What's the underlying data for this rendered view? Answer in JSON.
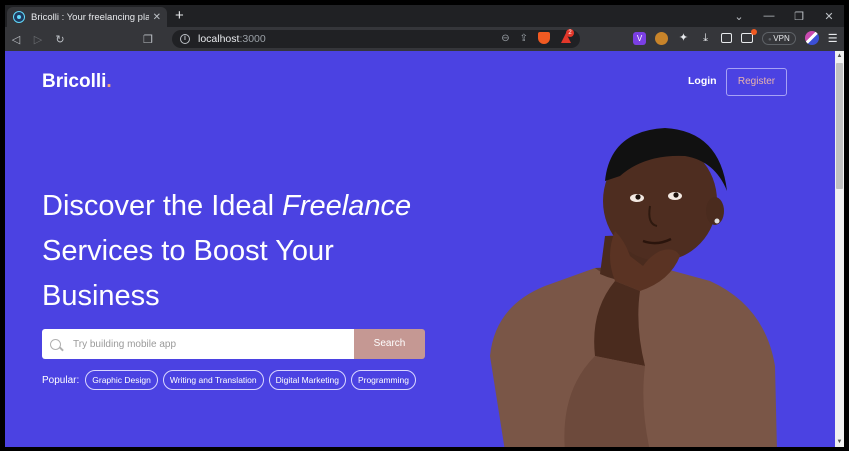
{
  "browser": {
    "tab_title": "Bricolli : Your freelancing platform",
    "tab_close": "✕",
    "new_tab": "+",
    "url_host": "localhost",
    "url_port": ":3000",
    "vpn_label": "VPN",
    "window_controls": [
      "⌄",
      "—",
      "❐",
      "✕"
    ]
  },
  "nav": {
    "logo": "Bricolli",
    "logo_dot": ".",
    "login": "Login",
    "register": "Register"
  },
  "hero": {
    "headline_part1": "Discover the Ideal ",
    "headline_italic": "Freelance",
    "headline_line2": "Services to Boost Your",
    "headline_line3": "Business",
    "search_placeholder": "Try building mobile app",
    "search_button": "Search",
    "popular_label": "Popular:",
    "popular_tags": [
      "Graphic Design",
      "Writing and Translation",
      "Digital Marketing",
      "Programming"
    ]
  },
  "colors": {
    "page_bg": "#4b42e2",
    "search_button": "#c59893",
    "register_text": "#e6b3ad",
    "logo_dot": "#f2a57a"
  }
}
